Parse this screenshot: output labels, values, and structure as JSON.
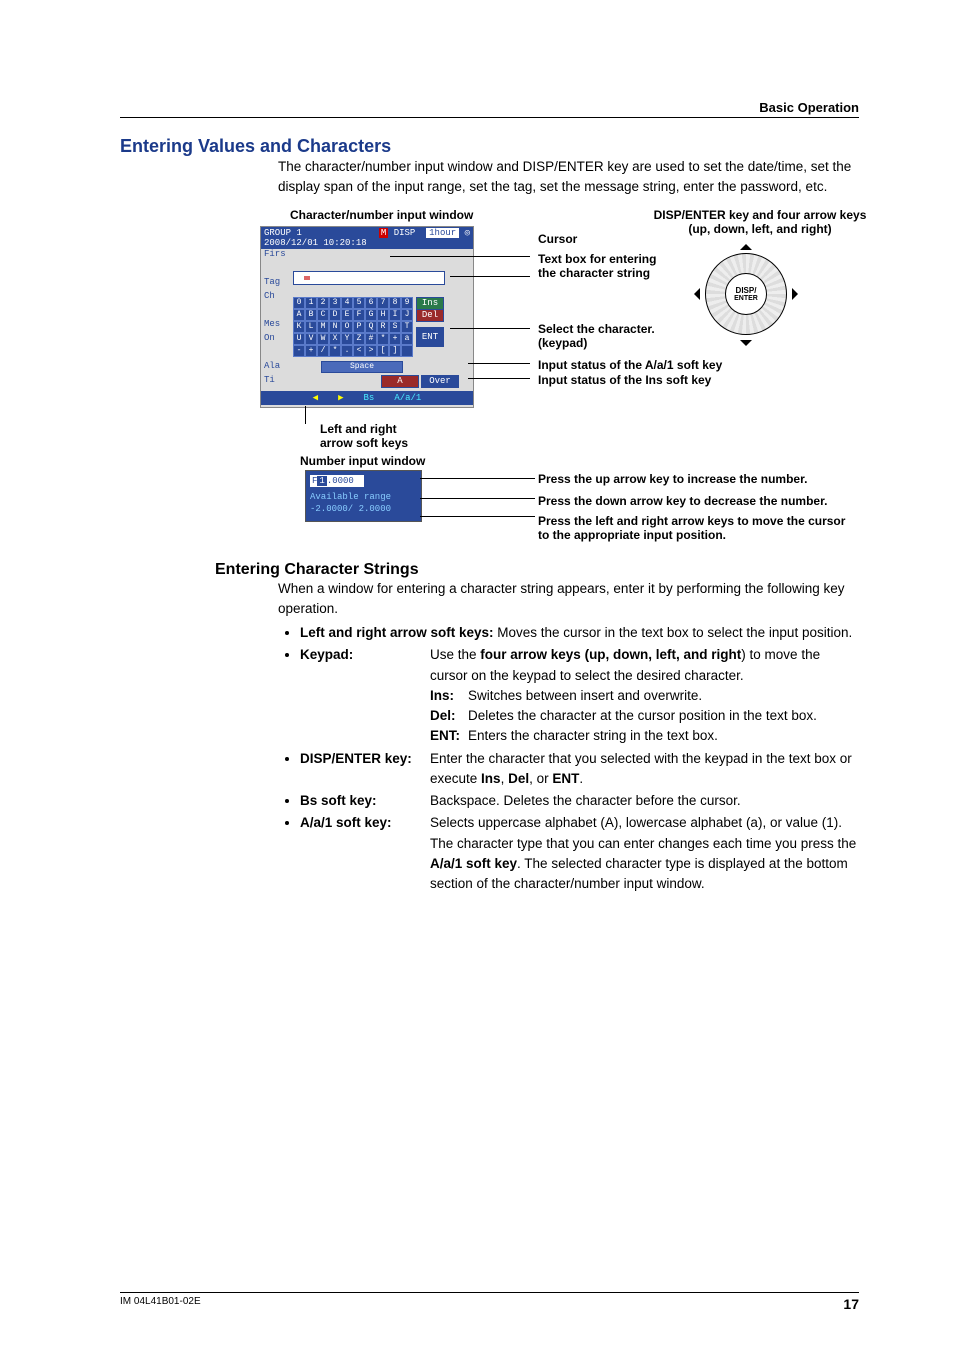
{
  "header": {
    "right": "Basic Operation"
  },
  "h1": "Entering Values and Characters",
  "intro": "The character/number input window and DISP/ENTER key are used to set the date/time, set the display span of the input range, set the tag, set the message string, enter the password, etc.",
  "figure": {
    "cw_title": "Character/number input window",
    "disp_title": "DISP/ENTER key and four arrow keys (up, down, left, and right)",
    "label_cursor": "Cursor",
    "label_textbox1": "Text box for entering",
    "label_textbox2": "the character string",
    "label_select1": "Select the character.",
    "label_select2": "(keypad)",
    "label_status_a": "Input status of the A/a/1 soft key",
    "label_status_ins": "Input status of the Ins soft key",
    "label_lr1": "Left and right",
    "label_lr2": "arrow soft keys",
    "label_numwin": "Number input window",
    "label_up": "Press the up arrow key to increase the number.",
    "label_down": "Press the down arrow key to decrease the number.",
    "label_lr_num1": "Press the left and right arrow keys to move the cursor",
    "label_lr_num2": "to the appropriate input position.",
    "cw": {
      "group": "GROUP 1",
      "date": "2008/12/01 10:20:18",
      "badge": "M",
      "disp": "DISP",
      "span": "1hour",
      "left_labels": [
        "Firs",
        "",
        "Tag",
        "Ch",
        "",
        "Mes",
        "On",
        "",
        "Ala",
        "Ti"
      ],
      "row0": [
        "0",
        "1",
        "2",
        "3",
        "4",
        "5",
        "6",
        "7",
        "8",
        "9"
      ],
      "row1": [
        "A",
        "B",
        "C",
        "D",
        "E",
        "F",
        "G",
        "H",
        "I",
        "J"
      ],
      "row2": [
        "K",
        "L",
        "M",
        "N",
        "O",
        "P",
        "Q",
        "R",
        "S",
        "T"
      ],
      "row3": [
        "U",
        "V",
        "W",
        "X",
        "Y",
        "Z",
        "#",
        "*",
        "+",
        "a"
      ],
      "row4": [
        "-",
        "+",
        "/",
        "*",
        ".",
        "<",
        ">",
        "[",
        "]",
        " "
      ],
      "ins": "Ins",
      "del": "Del",
      "ent": "ENT",
      "space": "Space",
      "st_a": "A",
      "st_over": "Over",
      "sk_bs": "Bs",
      "sk_aa1": "A/a/1"
    },
    "disp_key": {
      "l1": "DISP/",
      "l2": "ENTER"
    },
    "numwin": {
      "val_prefix": "F",
      "val_sel": "1",
      "val_rest": ".0000",
      "range_lbl": "Available range",
      "range_val": "-2.0000/ 2.0000"
    }
  },
  "h2": "Entering Character Strings",
  "ecs_intro": "When a window for entering a character string appears, enter it by performing the following key operation.",
  "keys": {
    "lr_label": "Left and right arrow soft keys:",
    "lr_text": " Moves the cursor in the text box to select the input position.",
    "keypad_label": "Keypad",
    "keypad_text1a": "Use the ",
    "keypad_text1b": "four arrow keys (up, down, left, and right",
    "keypad_text1c": ") to move the cursor on the keypad to select the desired character.",
    "ins_k": "Ins:",
    "ins_t": "Switches between insert and overwrite.",
    "del_k": "Del:",
    "del_t": "Deletes the character at the cursor position in the text box.",
    "ent_k": "ENT:",
    "ent_t": "Enters the character string in the text box.",
    "disp_label": "DISP/ENTER key",
    "disp_text1": "Enter the character that you selected with the keypad in the text box or execute ",
    "disp_b1": "Ins",
    "disp_sep1": ", ",
    "disp_b2": "Del",
    "disp_sep2": ", or ",
    "disp_b3": "ENT",
    "disp_text2": ".",
    "bs_label": "Bs soft key",
    "bs_text": "Backspace. Deletes the character before the cursor.",
    "aa1_label": "A/a/1 soft key",
    "aa1_text1": "Selects uppercase alphabet (A), lowercase alphabet (a), or value (1).",
    "aa1_text2a": "The character type that you can enter changes each time you press the ",
    "aa1_text2b": "A/a/1 soft key",
    "aa1_text2c": ". The selected character type is displayed at the bottom section of the character/number input window."
  },
  "footer": {
    "left": "IM 04L41B01-02E",
    "page": "17"
  }
}
